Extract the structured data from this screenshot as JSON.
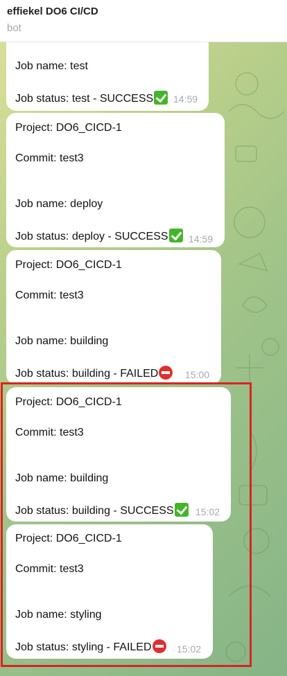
{
  "header": {
    "title": "effiekel DO6 CI/CD",
    "subtitle": "bot"
  },
  "messages": [
    {
      "lines": [
        "Job name: test",
        "Job status: test - SUCCESS"
      ],
      "status": "success",
      "time": "14:59"
    },
    {
      "lines": [
        "Project: DO6_CICD-1",
        "Commit: test3",
        "Job name: deploy",
        "Job status: deploy - SUCCESS"
      ],
      "status": "success",
      "time": "14:59"
    },
    {
      "lines": [
        "Project: DO6_CICD-1",
        "Commit: test3",
        "Job name: building",
        "Job status: building - FAILED"
      ],
      "status": "failed",
      "time": "15:00"
    },
    {
      "lines": [
        "Project: DO6_CICD-1",
        "Commit: test3",
        "Job name: building",
        "Job status: building - SUCCESS"
      ],
      "status": "success",
      "time": "15:02"
    },
    {
      "lines": [
        "Project: DO6_CICD-1",
        "Commit: test3",
        "Job name: styling",
        "Job status: styling - FAILED"
      ],
      "status": "failed",
      "time": "15:02"
    }
  ],
  "icons": {
    "success": "check-mark-icon",
    "failed": "no-entry-icon"
  },
  "colors": {
    "highlight": "#d92323",
    "success": "#44b52a",
    "failed": "#e02f2f"
  }
}
